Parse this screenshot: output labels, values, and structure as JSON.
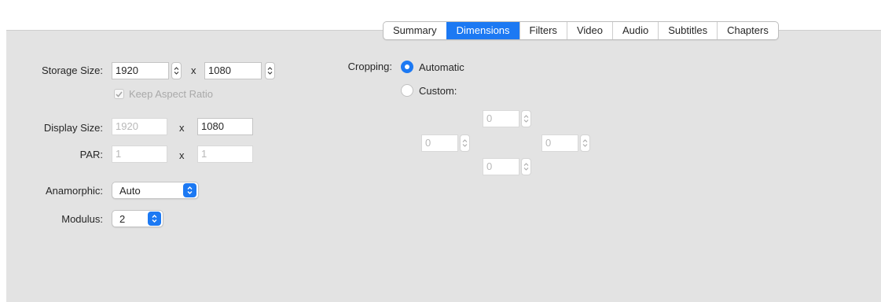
{
  "tabs": [
    {
      "label": "Summary",
      "active": false
    },
    {
      "label": "Dimensions",
      "active": true
    },
    {
      "label": "Filters",
      "active": false
    },
    {
      "label": "Video",
      "active": false
    },
    {
      "label": "Audio",
      "active": false
    },
    {
      "label": "Subtitles",
      "active": false
    },
    {
      "label": "Chapters",
      "active": false
    }
  ],
  "storage": {
    "label": "Storage Size:",
    "width": "1920",
    "height": "1080",
    "separator": "x"
  },
  "keep_aspect": {
    "label": "Keep Aspect Ratio",
    "checked": true,
    "enabled": false
  },
  "display": {
    "label": "Display Size:",
    "width": "1920",
    "height": "1080",
    "separator": "x"
  },
  "par": {
    "label": "PAR:",
    "width": "1",
    "height": "1",
    "separator": "x"
  },
  "anamorphic": {
    "label": "Anamorphic:",
    "value": "Auto"
  },
  "modulus": {
    "label": "Modulus:",
    "value": "2"
  },
  "cropping": {
    "label": "Cropping:",
    "automatic_label": "Automatic",
    "custom_label": "Custom:",
    "mode": "automatic",
    "top": "0",
    "left": "0",
    "right": "0",
    "bottom": "0"
  },
  "colors": {
    "accent": "#1c79f3",
    "panel": "#e3e3e3"
  }
}
